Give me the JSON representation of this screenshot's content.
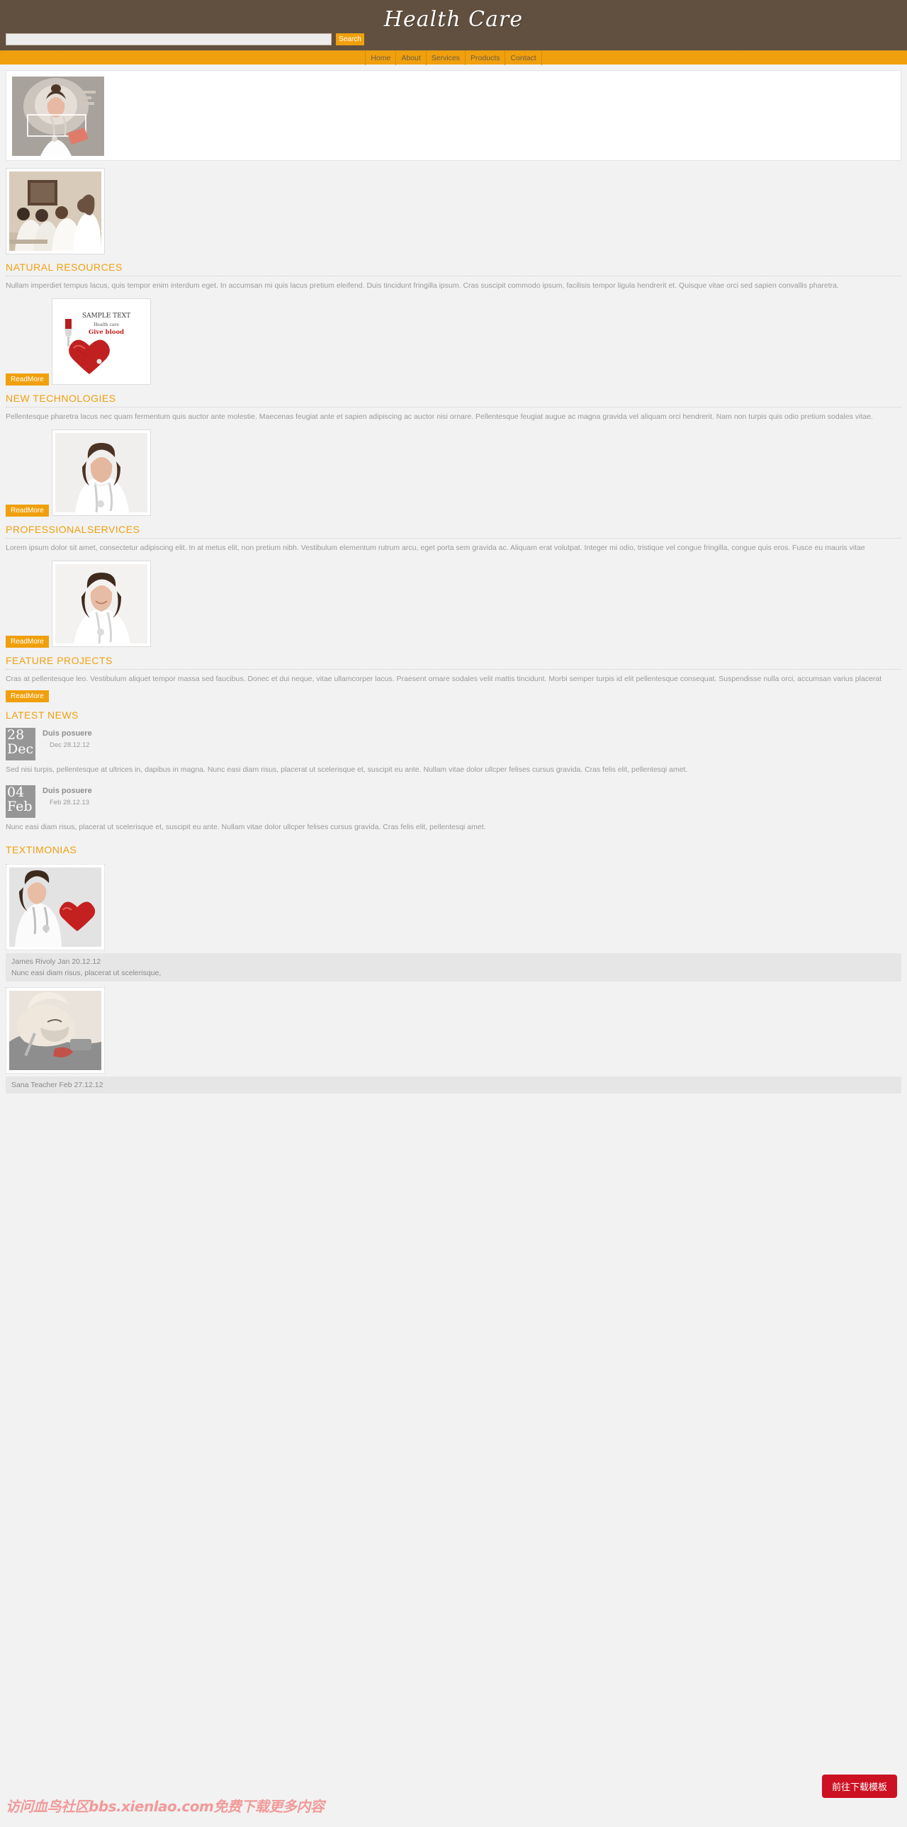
{
  "header": {
    "brand": "Health Care",
    "search": {
      "value": "",
      "placeholder": "",
      "button_label": "Search"
    }
  },
  "nav": {
    "items": [
      {
        "label": "Home"
      },
      {
        "label": "About"
      },
      {
        "label": "Services"
      },
      {
        "label": "Products"
      },
      {
        "label": "Contact"
      }
    ]
  },
  "featured": {
    "image_alt": "doctor-touchscreen-photo"
  },
  "sections": [
    {
      "id": "natural-resources",
      "image_alt": "medical-team-photo",
      "title": "NATURAL RESOURCES",
      "body": "Nullam imperdiet tempus lacus, quis tempor enim interdum eget. In accumsan mi quis lacus pretium eleifend. Duis tincidunt fringilla ipsum. Cras suscipit commodo ipsum, facilisis tempor ligula hendrerit et. Quisque vitae orci sed sapien convallis pharetra.",
      "readmore": "ReadMore"
    },
    {
      "id": "new-technologies",
      "image_alt": "give-blood-heart-photo",
      "title": "NEW TECHNOLOGIES",
      "body": "Pellentesque pharetra lacus nec quam fermentum quis auctor ante molestie. Maecenas feugiat ante et sapien adipiscing ac auctor nisi ornare. Pellentesque feugiat augue ac magna gravida vel aliquam orci hendrerit. Nam non turpis quis odio pretium sodales vitae.",
      "readmore": "ReadMore"
    },
    {
      "id": "professional-services",
      "image_alt": "female-doctor-stethoscope-photo",
      "title": "PROFESSIONALSERVICES",
      "body": "Lorem ipsum dolor sit amet, consectetur adipiscing elit. In at metus elit, non pretium nibh. Vestibulum elementum rutrum arcu, eget porta sem gravida ac. Aliquam erat volutpat. Integer mi odio, tristique vel congue fringilla, congue quis eros. Fusce eu mauris vitae",
      "readmore": "ReadMore"
    },
    {
      "id": "feature-projects",
      "image_alt": "smiling-doctor-photo",
      "title": "FEATURE PROJECTS",
      "body": "Cras at pellentesque leo. Vestibulum aliquet tempor massa sed faucibus. Donec et dui neque, vitae ullamcorper lacus. Praesent ornare sodales velit mattis tincidunt. Morbi semper turpis id elit pellentesque consequat. Suspendisse nulla orci, accumsan varius placerat",
      "readmore": "ReadMore"
    }
  ],
  "latest_news": {
    "title": "LATEST NEWS",
    "items": [
      {
        "day": "28",
        "month": "Dec",
        "title": "Duis posuere",
        "date": "Dec 28.12.12",
        "text": "Sed nisi turpis, pellentesque at ultrices in, dapibus in magna. Nunc easi diam risus, placerat ut scelerisque et, suscipit eu ante. Nullam vitae dolor ullcper felises cursus gravida. Cras felis elit, pellentesqi amet."
      },
      {
        "day": "04",
        "month": "Feb",
        "title": "Duis posuere",
        "date": "Feb 28.12.13",
        "text": "Nunc easi diam risus, placerat ut scelerisque et, suscipit eu ante. Nullam vitae dolor ullcper felises cursus gravida. Cras felis elit, pellentesqi amet."
      }
    ]
  },
  "testimonials": {
    "title": "TEXTIMONIAS",
    "items": [
      {
        "image_alt": "nurse-heart-stethoscope-photo",
        "author": "James Rivoly Jan 20.12.12",
        "quote": "Nunc easi diam risus, placerat ut scelerisque,"
      },
      {
        "image_alt": "surgeon-mask-photo",
        "author": "Sana Teacher Feb 27.12.12",
        "quote": ""
      }
    ]
  },
  "overlay": {
    "watermark": "访问血鸟社区bbs.xienlao.com免费下载更多内容",
    "download_button": "前往下载模板"
  },
  "colors": {
    "header_brown": "#61503f",
    "accent_orange": "#f0a00d",
    "page_bg": "#f2f2f2",
    "text_gray": "#9a9a9a",
    "badge_gray": "#969696",
    "download_red": "#cc1122",
    "watermark_pink": "#f29a9a"
  }
}
